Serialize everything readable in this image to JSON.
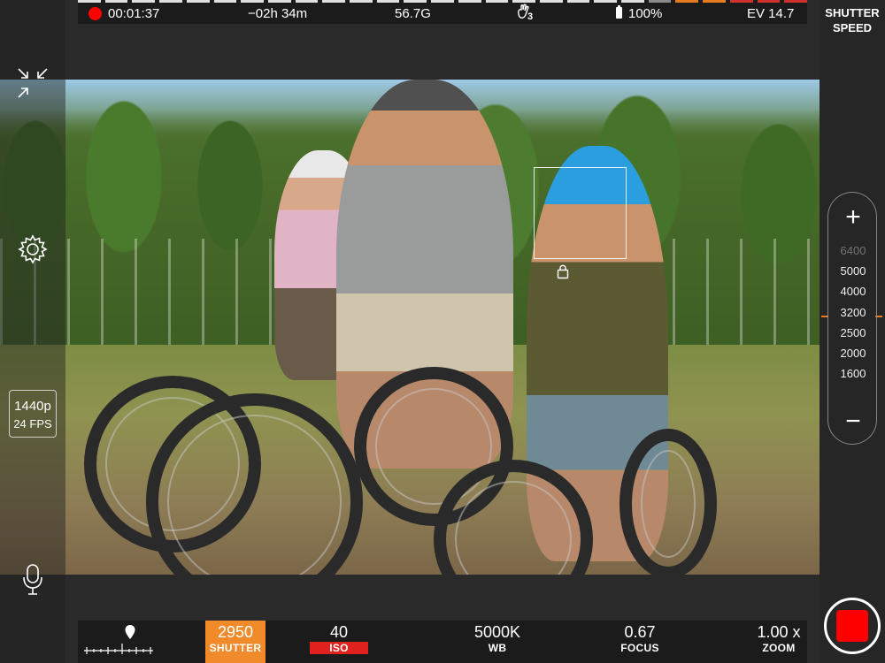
{
  "status": {
    "timecode": "00:01:37",
    "remaining": "−02h 34m",
    "storage": "56.7G",
    "stabilizer_level": "3",
    "battery": "100%",
    "ev": "EV 14.7"
  },
  "side_panel": {
    "title_line1": "SHUTTER",
    "title_line2": "SPEED"
  },
  "left": {
    "resolution": "1440p",
    "fps": "24 FPS"
  },
  "slider": {
    "plus": "+",
    "minus": "−",
    "scale": [
      "6400",
      "5000",
      "4000",
      "3200",
      "2500",
      "2000",
      "1600"
    ],
    "current_index": 3
  },
  "bottom": {
    "shutter": {
      "value": "2950",
      "label": "SHUTTER"
    },
    "iso": {
      "value": "40",
      "label": "ISO"
    },
    "wb": {
      "value": "5000K",
      "label": "WB"
    },
    "focus": {
      "value": "0.67",
      "label": "FOCUS"
    },
    "zoom": {
      "value": "1.00 x",
      "label": "ZOOM"
    }
  },
  "colors": {
    "accent_orange": "#f08a2a",
    "record_red": "#ff0000",
    "iso_red": "#e0211e"
  }
}
